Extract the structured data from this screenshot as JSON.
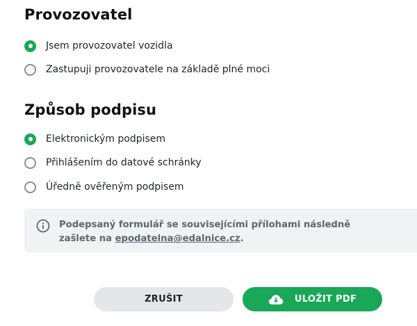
{
  "operator_section": {
    "title": "Provozovatel",
    "options": [
      {
        "label": "Jsem provozovatel vozidla",
        "checked": true
      },
      {
        "label": "Zastupuji provozovatele na základě plné moci",
        "checked": false
      }
    ]
  },
  "signature_section": {
    "title": "Způsob podpisu",
    "options": [
      {
        "label": "Elektronickým podpisem",
        "checked": true
      },
      {
        "label": "Přihlášením do datové schránky",
        "checked": false
      },
      {
        "label": "Úředně ověřeným podpisem",
        "checked": false
      }
    ]
  },
  "info": {
    "icon": "info-icon",
    "text_before": "Podepsaný formulář se souvisejícími přílohami následně zašlete na ",
    "email": "epodatelna@edalnice.cz",
    "text_after": "."
  },
  "buttons": {
    "cancel_label": "ZRUŠIT",
    "save_label": "ULOŽIT PDF",
    "save_icon": "cloud-download-icon"
  },
  "colors": {
    "accent": "#18a857",
    "info_bg": "#f1f2f3",
    "cancel_bg": "#e4e7ea"
  }
}
